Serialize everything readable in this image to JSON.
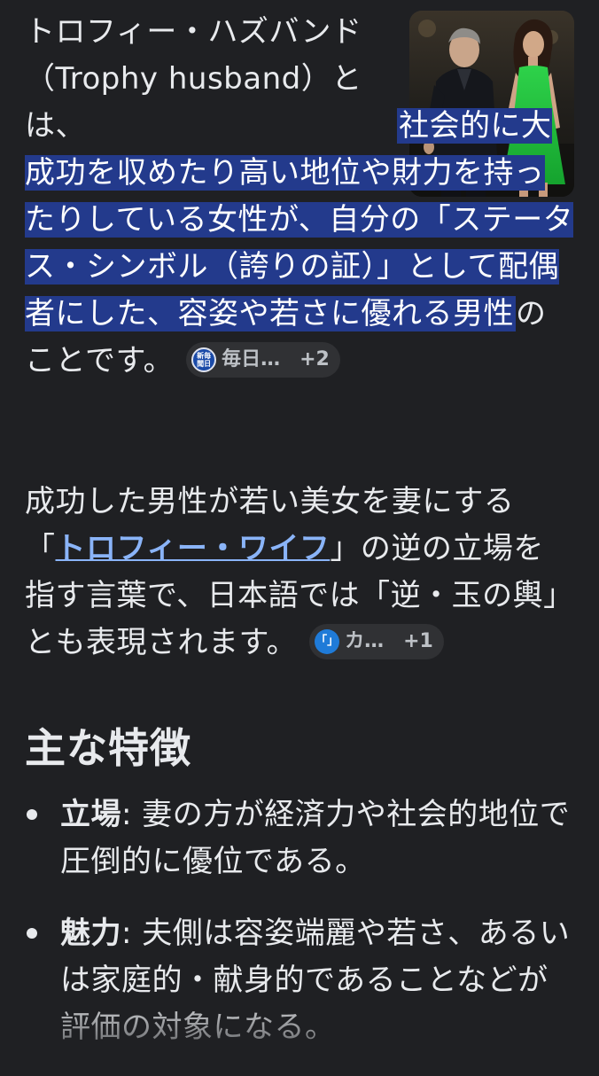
{
  "intro": {
    "plain_start": "トロフィー・ハズバンド（Trophy husband）とは、",
    "highlighted": "社会的に大成功を収めたり高い地位や財力を持ったりしている女性が、自分の「ステータス・シンボル（誇りの証）」として配偶者にした、容姿や若さに優れる男性",
    "plain_end": "のことです。",
    "source_chip": {
      "favicon_text": "新毎\n聞日",
      "label": "毎日…",
      "more": "+2"
    }
  },
  "para2": {
    "text_before": "成功した男性が若い美女を妻にする「",
    "link_text": "トロフィー・ワイフ",
    "text_after": "」の逆の立場を指す言葉で、日本語では「逆・玉の輿」とも表現されます。",
    "source_chip": {
      "favicon_text": "「」",
      "label": "カ…",
      "more": "+1"
    }
  },
  "section": {
    "heading": "主な特徴",
    "items": [
      {
        "term": "立場",
        "separator": ": ",
        "text": "妻の方が経済力や社会的地位で圧倒的に優位である。"
      },
      {
        "term": "魅力",
        "separator": ": ",
        "text": "夫側は容姿端麗や若さ、あるいは家庭的・献身的であることなどが評価の対象になる。"
      }
    ]
  },
  "colors": {
    "background": "#1f2023",
    "text": "#e8eaed",
    "highlight": "#233a8c",
    "link": "#8ab4f8",
    "chip_bg": "#303134"
  }
}
